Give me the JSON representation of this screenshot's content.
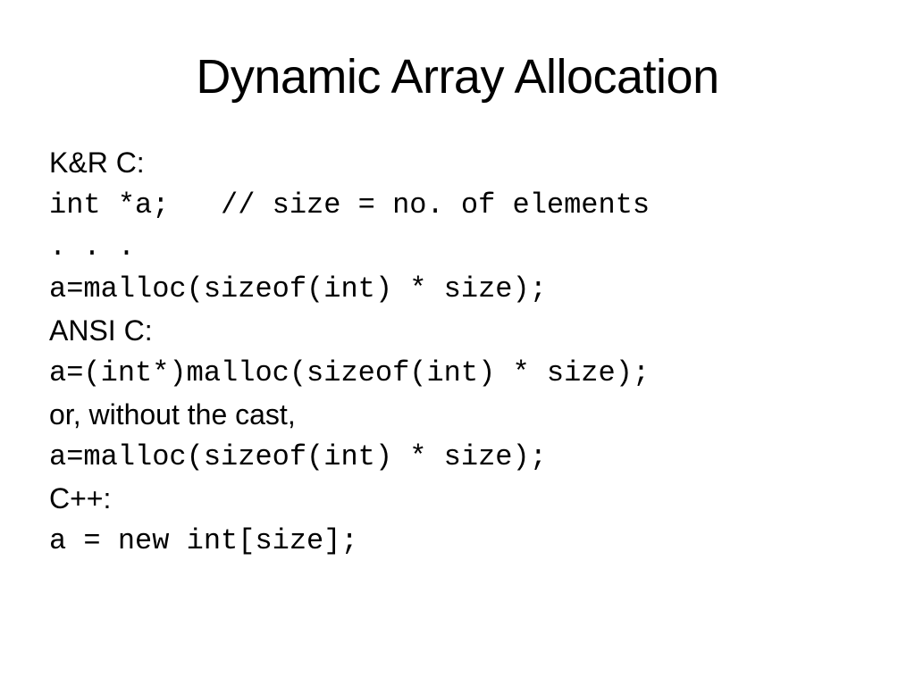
{
  "title": "Dynamic Array Allocation",
  "lines": {
    "label_kr": "K&R C:",
    "code1": "int *a;   // size = no. of elements",
    "code2": ". . .",
    "code3": "a=malloc(sizeof(int) * size);",
    "label_ansi": "ANSI C:",
    "code4": "a=(int*)malloc(sizeof(int) * size);",
    "label_cast": "or, without the cast,",
    "code5": "a=malloc(sizeof(int) * size);",
    "label_cpp": "C++:",
    "code6": "a = new int[size];"
  }
}
